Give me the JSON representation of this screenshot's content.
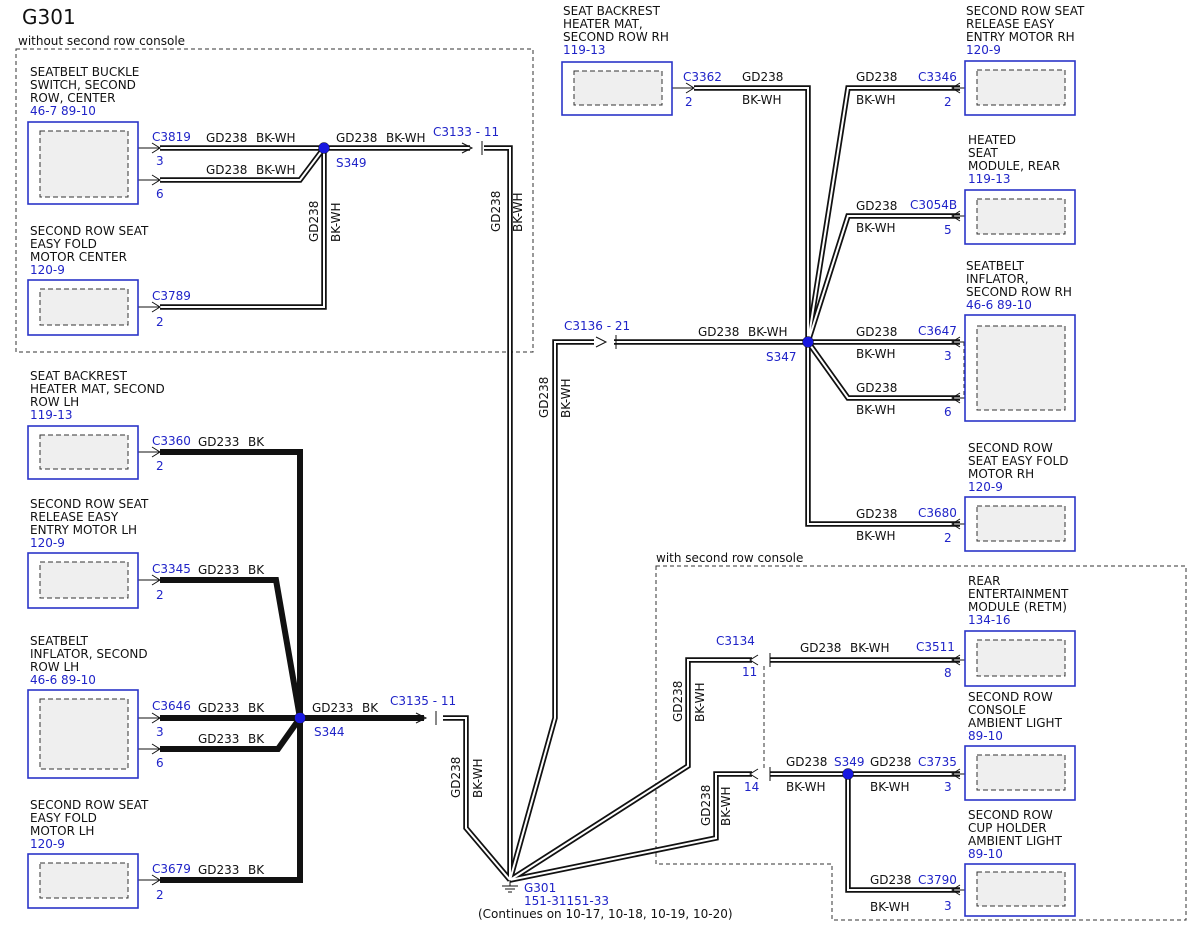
{
  "title": "G301",
  "regions": {
    "no_console": "without second row console",
    "with_console": "with second row console"
  },
  "ground": {
    "name": "G301",
    "refs": "151-31151-33",
    "continues": "(Continues on 10-17, 10-18, 10-19, 10-20)"
  },
  "splices": {
    "s349_top": "S349",
    "s344": "S344",
    "s347": "S347",
    "s349_console": "S349"
  },
  "inline_connectors": {
    "c3133": "C3133 - 11",
    "c3135": "C3135 - 11",
    "c3136": "C3136 - 21",
    "c3134": "C3134",
    "c3134_pin11": "11",
    "c3134_pin14": "14"
  },
  "components": {
    "buckle_center": {
      "l1": "SEATBELT BUCKLE",
      "l2": "SWITCH, SECOND",
      "l3": "ROW, CENTER",
      "ref": "46-7   89-10",
      "conn": "C3819",
      "pin_a": "3",
      "pin_b": "6"
    },
    "fold_center": {
      "l1": "SECOND ROW SEAT",
      "l2": "EASY FOLD",
      "l3": "MOTOR CENTER",
      "ref": "120-9",
      "conn": "C3789",
      "pin": "2"
    },
    "heater_lh": {
      "l1": "SEAT BACKREST",
      "l2": "HEATER MAT, SECOND",
      "l3": "ROW LH",
      "ref": "119-13",
      "conn": "C3360",
      "pin": "2"
    },
    "release_lh": {
      "l1": "SECOND ROW SEAT",
      "l2": "RELEASE EASY",
      "l3": "ENTRY MOTOR LH",
      "ref": "120-9",
      "conn": "C3345",
      "pin": "2"
    },
    "inflator_lh": {
      "l1": "SEATBELT",
      "l2": "INFLATOR, SECOND",
      "l3": "ROW LH",
      "ref": "46-6   89-10",
      "conn": "C3646",
      "pin_a": "3",
      "pin_b": "6"
    },
    "fold_lh": {
      "l1": "SECOND ROW SEAT",
      "l2": "EASY FOLD",
      "l3": "MOTOR LH",
      "ref": "120-9",
      "conn": "C3679",
      "pin": "2"
    },
    "heater_rh": {
      "l1": "SEAT BACKREST",
      "l2": "HEATER MAT,",
      "l3": "SECOND ROW RH",
      "ref": "119-13",
      "conn": "C3362",
      "pin": "2"
    },
    "release_rh": {
      "l1": "SECOND ROW SEAT",
      "l2": "RELEASE EASY",
      "l3": "ENTRY MOTOR RH",
      "ref": "120-9",
      "conn": "C3346",
      "pin": "2"
    },
    "heated_module": {
      "l1": "HEATED",
      "l2": "SEAT",
      "l3": "MODULE, REAR",
      "ref": "119-13",
      "conn": "C3054B",
      "pin": "5"
    },
    "inflator_rh": {
      "l1": "SEATBELT",
      "l2": "INFLATOR,",
      "l3": "SECOND ROW RH",
      "ref": "46-6   89-10",
      "conn": "C3647",
      "pin_a": "3",
      "pin_b": "6"
    },
    "fold_rh": {
      "l1": "SECOND ROW",
      "l2": "SEAT EASY FOLD",
      "l3": "MOTOR RH",
      "ref": "120-9",
      "conn": "C3680",
      "pin": "2"
    },
    "retm": {
      "l1": "REAR",
      "l2": "ENTERTAINMENT",
      "l3": "MODULE (RETM)",
      "ref": "134-16",
      "conn": "C3511",
      "pin": "8"
    },
    "console_light": {
      "l1": "SECOND ROW",
      "l2": "CONSOLE",
      "l3": "AMBIENT LIGHT",
      "ref": "89-10",
      "conn": "C3735",
      "pin": "3"
    },
    "cupholder_light": {
      "l1": "SECOND ROW",
      "l2": "CUP HOLDER",
      "l3": "AMBIENT LIGHT",
      "ref": "89-10",
      "conn": "C3790",
      "pin": "3"
    }
  },
  "wires": {
    "gd238": "GD238",
    "gd233": "GD233",
    "bkwh": "BK-WH",
    "bk": "BK"
  }
}
